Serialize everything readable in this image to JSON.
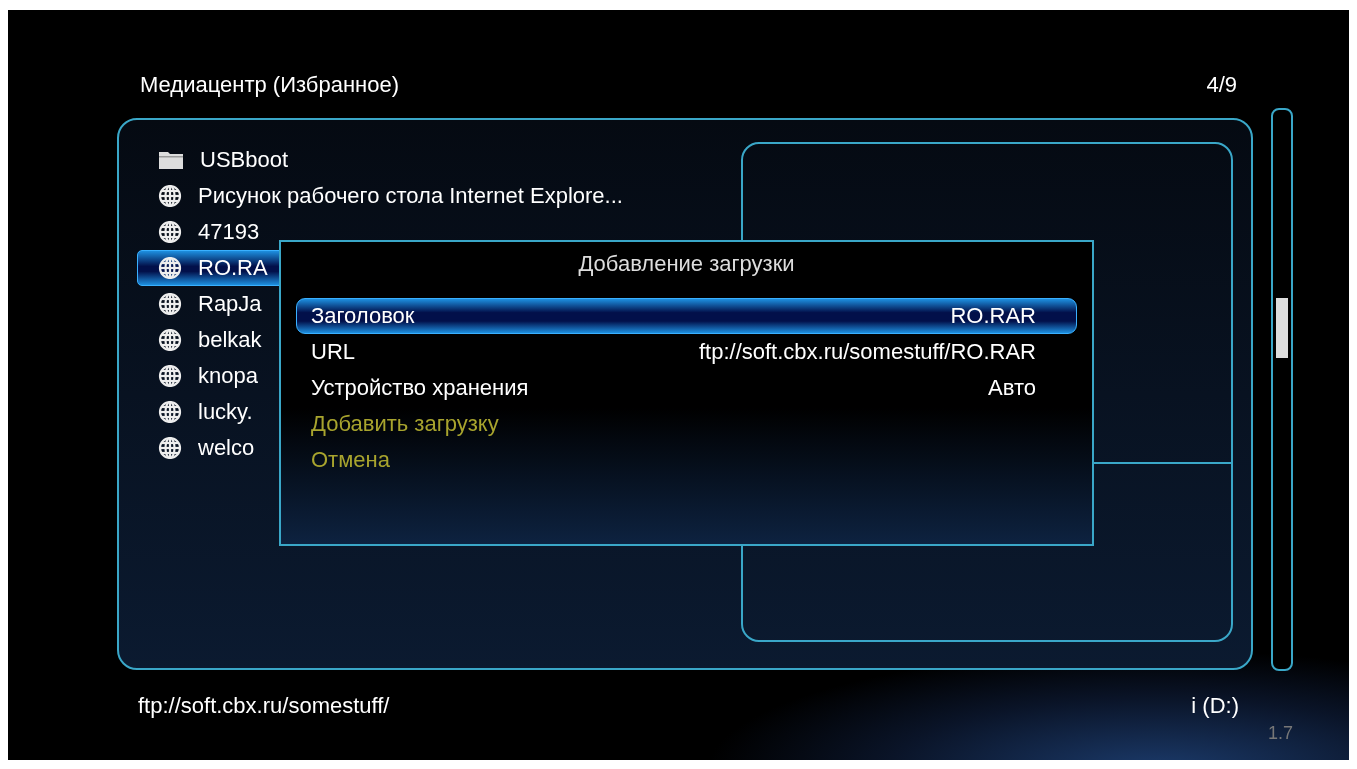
{
  "header": {
    "title": "Медиацентр (Избранное)",
    "counter": "4/9"
  },
  "items": [
    {
      "kind": "folder",
      "label": "USBboot",
      "selected": false
    },
    {
      "kind": "link",
      "label": "Рисунок рабочего стола Internet Explore...",
      "selected": false
    },
    {
      "kind": "link",
      "label": "47193",
      "selected": false
    },
    {
      "kind": "link",
      "label": "RO.RA",
      "selected": true
    },
    {
      "kind": "link",
      "label": "RapJa",
      "selected": false
    },
    {
      "kind": "link",
      "label": "belkak",
      "selected": false
    },
    {
      "kind": "link",
      "label": "knopa",
      "selected": false
    },
    {
      "kind": "link",
      "label": "lucky.",
      "selected": false
    },
    {
      "kind": "link",
      "label": "welco",
      "selected": false
    }
  ],
  "dialog": {
    "title": "Добавление загрузки",
    "rows": [
      {
        "kind": "field",
        "label": "Заголовок",
        "value": "RO.RAR",
        "selected": true
      },
      {
        "kind": "field",
        "label": "URL",
        "value": "ftp://soft.cbx.ru/somestuff/RO.RAR",
        "selected": false
      },
      {
        "kind": "field",
        "label": "Устройство хранения",
        "value": "Авто",
        "selected": false
      },
      {
        "kind": "action",
        "label": "Добавить загрузку",
        "selected": false
      },
      {
        "kind": "action",
        "label": "Отмена",
        "selected": false
      }
    ]
  },
  "footer": {
    "path": "ftp://soft.cbx.ru/somestuff/",
    "device": "i (D:)",
    "version": "1.7"
  }
}
